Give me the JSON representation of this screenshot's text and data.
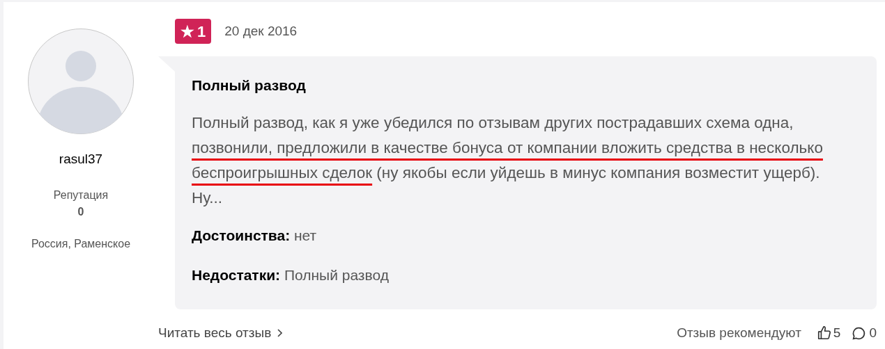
{
  "author": {
    "username": "rasul37",
    "reputation_label": "Репутация",
    "reputation": "0",
    "location": "Россия, Раменское"
  },
  "rating": {
    "icon": "★",
    "value": "1"
  },
  "date": "20 дек 2016",
  "review": {
    "title": "Полный развод",
    "body": [
      {
        "text": "Полный развод, как я уже убедился по отзывам других пострадавших схема одна, ",
        "underlined": false
      },
      {
        "text": "позвонили, предложили в качестве бонуса от компании вложить средства в несколько беспроигрышных сделок",
        "underlined": true
      },
      {
        "text": " (ну якобы если уйдешь в минус компания возместит ущерб). Ну...",
        "underlined": false
      }
    ],
    "pros_label": "Достоинства:",
    "pros": "нет",
    "cons_label": "Недостатки:",
    "cons": "Полный развод"
  },
  "footer": {
    "read_more": "Читать весь отзыв",
    "recommend_label": "Отзыв рекомендуют",
    "likes": "5",
    "comments": "0"
  }
}
